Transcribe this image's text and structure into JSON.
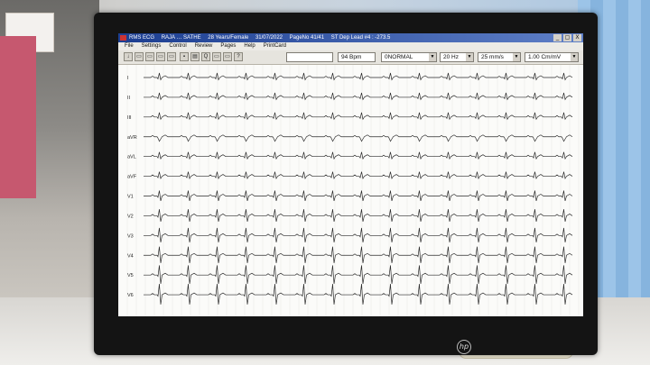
{
  "window": {
    "title_parts": [
      "RMS ECG",
      "RAJA … SATHE",
      "28 Years/Female",
      "31/07/2022",
      "PageNo 41/41",
      "ST Dep Lead #4 : -273.5"
    ],
    "controls": [
      "_",
      "▢",
      "X"
    ]
  },
  "menu": [
    "File",
    "Settings",
    "Control",
    "Review",
    "Pages",
    "Help",
    "PrintCard"
  ],
  "toolbar": {
    "tools": [
      "↓",
      "▭",
      "▭",
      "▭",
      "▭",
      "▪",
      "▤",
      "Q",
      "▭",
      "▭",
      "?"
    ],
    "search_value": "",
    "heart_rate": "94 Bpm",
    "rhythm": "0NORMAL",
    "filter": "20 Hz",
    "speed": "25 mm/s",
    "gain": "1.00 Cm/mV"
  },
  "leads": [
    "I",
    "II",
    "III",
    "aVR",
    "aVL",
    "aVF",
    "V1",
    "V2",
    "V3",
    "V4",
    "V5",
    "V6"
  ],
  "room": {
    "remote_display": ""
  }
}
